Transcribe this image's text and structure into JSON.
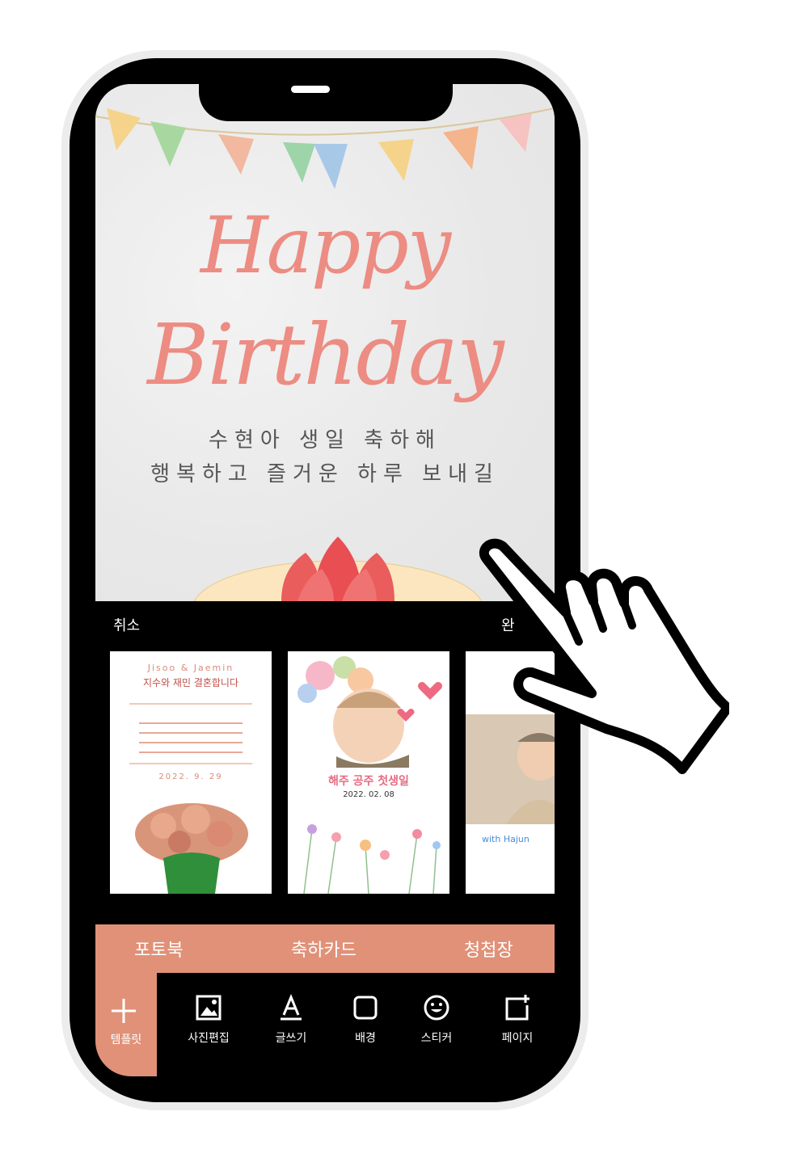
{
  "card": {
    "title_line1": "Happy",
    "title_line2": "Birthday",
    "message_line1": "수현아 생일 축하해",
    "message_line2": "행복하고 즐거운 하루 보내길"
  },
  "panel": {
    "cancel_label": "취소",
    "done_label": "완",
    "templates": [
      {
        "name_en": "Jisoo & Jaemin",
        "headline": "지수와 재민 결혼합니다",
        "date": "2022. 9. 29"
      },
      {
        "headline": "해주 공주 첫생일",
        "date": "2022. 02. 08"
      },
      {
        "caption": "with Hajun"
      }
    ]
  },
  "categories": [
    "포토북",
    "축하카드",
    "청첩장"
  ],
  "toolbar": {
    "template_label": "템플릿",
    "tools": [
      "사진편집",
      "글쓰기",
      "배경",
      "스티커",
      "페이지"
    ]
  },
  "colors": {
    "accent": "#e09178",
    "title": "#ec8c82"
  }
}
